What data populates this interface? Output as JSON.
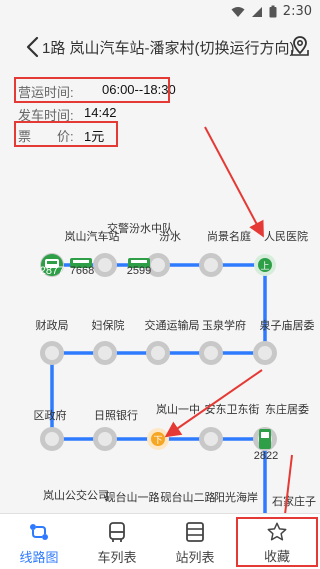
{
  "status_bar": {
    "time": "2:30"
  },
  "header": {
    "title": "1路 岚山汽车站-潘家村(切换运行方向)"
  },
  "info": {
    "operating_label": "营运时间:",
    "operating_value": "06:00--18:30",
    "departure_label": "发车时间:",
    "departure_value": "14:42",
    "fare_label": "票　　价:",
    "fare_value": "1元"
  },
  "stops": [
    "岚山汽车站",
    "交警汾水中队",
    "汾水",
    "尚景名庭",
    "人民医院",
    "泉子庙居委",
    "玉泉学府",
    "交通运输局",
    "妇保院",
    "财政局",
    "区政府",
    "日照银行",
    "岚山一中",
    "安东卫东街",
    "东庄居委",
    "岚山公交公司",
    "砚台山一路",
    "砚台山二路",
    "阳光海岸",
    "石家庄子"
  ],
  "buses": [
    "2877",
    "7668",
    "2599",
    "2822"
  ],
  "markers": {
    "board": "上",
    "alight": "下"
  },
  "colors": {
    "route": "#2f7bff",
    "highlight": "#e53935",
    "bus": "#2e9e47",
    "alight": "#f5a623",
    "active_tab": "#2f7bff"
  },
  "nav": {
    "tabs": [
      {
        "label": "线路图",
        "icon": "route-map-icon",
        "active": true
      },
      {
        "label": "车列表",
        "icon": "bus-icon",
        "active": false
      },
      {
        "label": "站列表",
        "icon": "station-list-icon",
        "active": false
      },
      {
        "label": "收藏",
        "icon": "star-icon",
        "active": false
      }
    ]
  }
}
